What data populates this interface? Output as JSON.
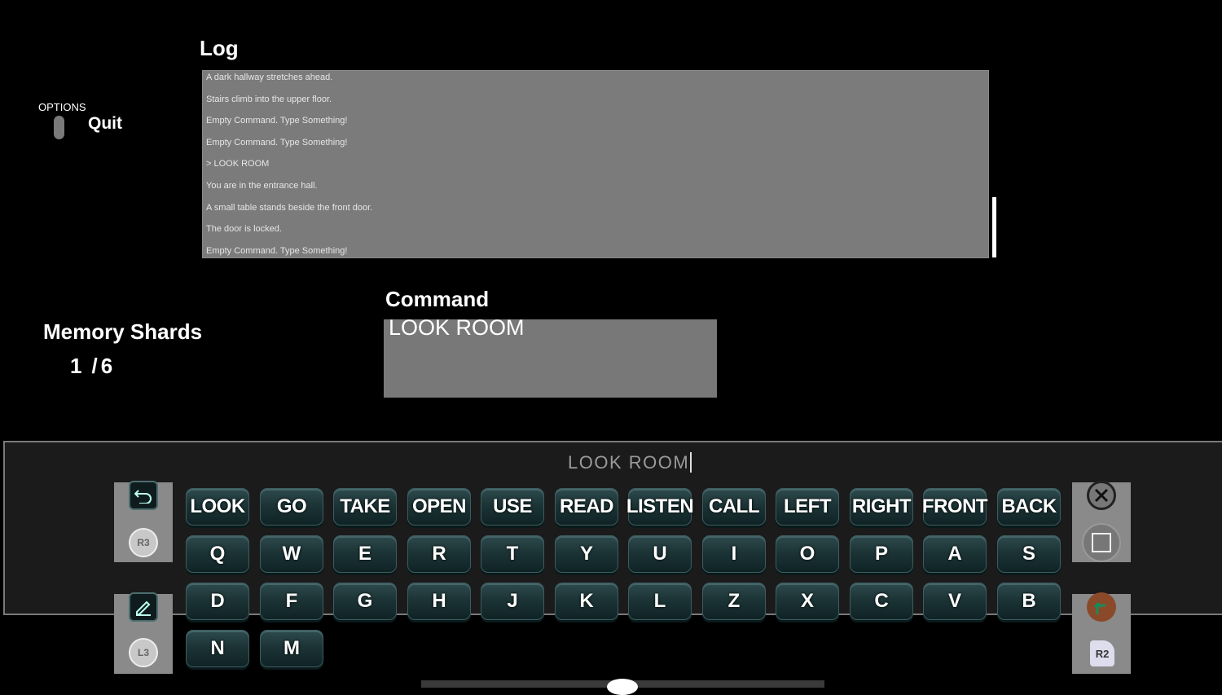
{
  "log": {
    "title": "Log",
    "lines": [
      "A dark hallway stretches ahead.",
      "Stairs climb into the upper floor.",
      "Empty Command. Type Something!",
      "Empty Command. Type Something!",
      "> LOOK ROOM",
      "You are in the entrance hall.",
      "A small table stands beside the front door.",
      "The door is locked.",
      "Empty Command. Type Something!"
    ]
  },
  "options": {
    "label": "OPTIONS",
    "quit_label": "Quit"
  },
  "memory_shards": {
    "label": "Memory Shards",
    "current": "1",
    "separator": "/",
    "total": "6"
  },
  "command": {
    "title": "Command",
    "value": "LOOK ROOM"
  },
  "keyboard": {
    "input_value": "LOOK ROOM",
    "rows": [
      [
        "LOOK",
        "GO",
        "TAKE",
        "OPEN",
        "USE",
        "READ",
        "LISTEN",
        "CALL",
        "LEFT",
        "RIGHT",
        "FRONT",
        "BACK"
      ],
      [
        "Q",
        "W",
        "E",
        "R",
        "T",
        "Y",
        "U",
        "I",
        "O",
        "P",
        "A",
        "S"
      ],
      [
        "D",
        "F",
        "G",
        "H",
        "J",
        "K",
        "L",
        "Z",
        "X",
        "C",
        "V",
        "B"
      ],
      [
        "N",
        "M"
      ]
    ],
    "left_controls": {
      "top": {
        "action_icon": "undo-icon",
        "button_icon": "r3-stick-icon",
        "button_text": "R3"
      },
      "bottom": {
        "action_icon": "edit-icon",
        "button_icon": "l3-stick-icon",
        "button_text": "L3"
      }
    },
    "right_controls": {
      "top": {
        "action_icon": "cross-button-icon",
        "button_icon": "square-button-icon"
      },
      "bottom": {
        "action_icon": "enter-arrow-icon",
        "button_icon": "r2-button-icon",
        "button_text": "R2"
      }
    }
  },
  "colors": {
    "log_bg": "#7b7b7b",
    "command_bg": "#787878",
    "key_bg": "#1c3436",
    "panel_bg": "#1b1b1b"
  }
}
